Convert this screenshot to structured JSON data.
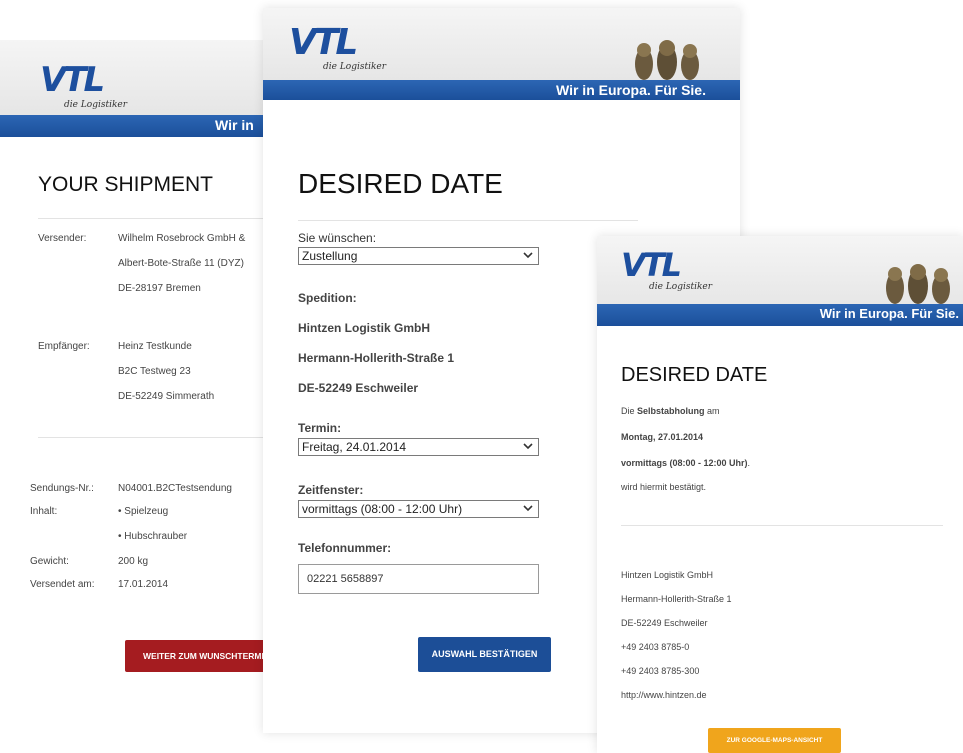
{
  "brand": {
    "logo_text": "VTL",
    "logo_tagline": "die Logistiker",
    "slogan": "Wir in Europa. Für Sie.",
    "slogan_cut": "Wir in",
    "colors": {
      "blue": "#1c4e97",
      "red": "#a51c20",
      "orange": "#f0a51c",
      "logo_red": "#c9211e"
    }
  },
  "card1": {
    "title": "YOUR SHIPMENT",
    "sender": {
      "label": "Versender:",
      "lines": [
        "Wilhelm Rosebrock GmbH &",
        "Albert-Bote-Straße 11 (DYZ)",
        "DE-28197 Bremen"
      ]
    },
    "recipient": {
      "label": "Empfänger:",
      "lines": [
        "Heinz Testkunde",
        "B2C Testweg 23",
        "DE-52249 Simmerath"
      ]
    },
    "shipment_no": {
      "label": "Sendungs-Nr.:",
      "value": "N04001.B2CTestsendung"
    },
    "content": {
      "label": "Inhalt:",
      "items": [
        "• Spielzeug",
        "• Hubschrauber"
      ]
    },
    "weight": {
      "label": "Gewicht:",
      "value": "200 kg"
    },
    "shipped": {
      "label": "Versendet am:",
      "value": "17.01.2014"
    },
    "button": "WEITER ZUM WUNSCHTERMIN"
  },
  "card2": {
    "title": "DESIRED DATE",
    "wish": {
      "label": "Sie wünschen:",
      "value": "Zustellung"
    },
    "carrier": {
      "label": "Spedition:",
      "lines": [
        "Hintzen Logistik GmbH",
        "Hermann-Hollerith-Straße 1",
        "DE-52249 Eschweiler"
      ]
    },
    "appointment": {
      "label": "Termin:",
      "value": "Freitag, 24.01.2014"
    },
    "timeslot": {
      "label": "Zeitfenster:",
      "value": "vormittags (08:00 - 12:00 Uhr)"
    },
    "phone": {
      "label": "Telefonnummer:",
      "value": "02221 5658897"
    },
    "button": "AUSWAHL BESTÄTIGEN"
  },
  "card3": {
    "title": "DESIRED DATE",
    "confirm": {
      "prefix": "Die",
      "bold": "Selbstabholung",
      "suffix": "am",
      "date": "Montag, 27.01.2014",
      "time": "vormittags (08:00 - 12:00 Uhr)",
      "time_end": ".",
      "tail": "wird hiermit bestätigt."
    },
    "contact": [
      "Hintzen Logistik GmbH",
      "Hermann-Hollerith-Straße 1",
      "DE-52249 Eschweiler",
      "+49 2403 8785-0",
      "+49 2403 8785-300",
      "http://www.hintzen.de"
    ],
    "button": "ZUR GOOGLE-MAPS-ANSICHT"
  }
}
